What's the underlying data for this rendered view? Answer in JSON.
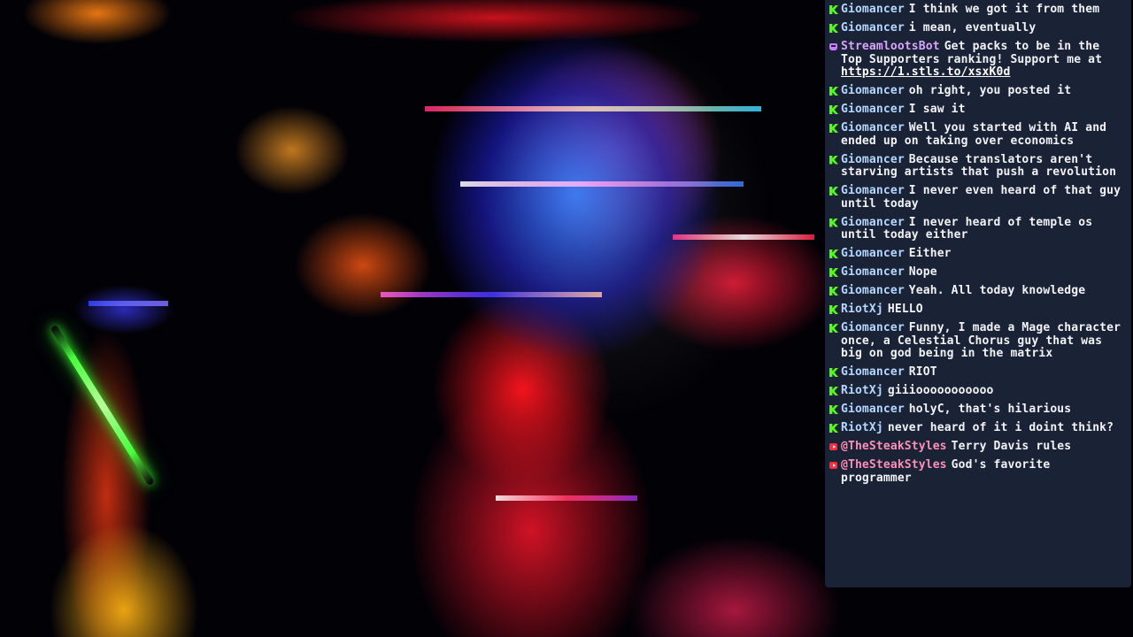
{
  "colors": {
    "kick_username": "#b4d8ff",
    "youtube_username": "#ff8fb8",
    "bot_username": "#d9a3ff",
    "chat_text": "#f1f3f7",
    "chat_panel_bg": "#1c2438",
    "kick_icon": "#53fc18",
    "youtube_icon": "#ff2b3a",
    "bot_icon": "#c77dff"
  },
  "chat": {
    "messages": [
      {
        "platform_icon": "kick-icon",
        "username": "Giomancer",
        "text": "I think we got it from them"
      },
      {
        "platform_icon": "kick-icon",
        "username": "Giomancer",
        "text": "i mean, eventually"
      },
      {
        "platform_icon": "bot-icon",
        "username": "StreamlootsBot",
        "text": "Get packs to be in the Top Supporters ranking! Support me at",
        "link": "https://1.stls.to/xsxK0d"
      },
      {
        "platform_icon": "kick-icon",
        "username": "Giomancer",
        "text": "oh right, you posted it"
      },
      {
        "platform_icon": "kick-icon",
        "username": "Giomancer",
        "text": "I saw it"
      },
      {
        "platform_icon": "kick-icon",
        "username": "Giomancer",
        "text": "Well you started with AI and ended up on taking over economics"
      },
      {
        "platform_icon": "kick-icon",
        "username": "Giomancer",
        "text": "Because translators aren't starving artists that push a revolution"
      },
      {
        "platform_icon": "kick-icon",
        "username": "Giomancer",
        "text": "I never even heard of that guy until today"
      },
      {
        "platform_icon": "kick-icon",
        "username": "Giomancer",
        "text": "I never heard of temple os until today either"
      },
      {
        "platform_icon": "kick-icon",
        "username": "Giomancer",
        "text": "Either"
      },
      {
        "platform_icon": "kick-icon",
        "username": "Giomancer",
        "text": "Nope"
      },
      {
        "platform_icon": "kick-icon",
        "username": "Giomancer",
        "text": "Yeah. All today knowledge"
      },
      {
        "platform_icon": "kick-icon",
        "username": "RiotXj",
        "text": "HELLO"
      },
      {
        "platform_icon": "kick-icon",
        "username": "Giomancer",
        "text": "Funny, I made a Mage character once, a Celestial Chorus guy that was big on god being in the matrix"
      },
      {
        "platform_icon": "kick-icon",
        "username": "Giomancer",
        "text": "RIOT"
      },
      {
        "platform_icon": "kick-icon",
        "username": "RiotXj",
        "text": "giiiooooooooooo"
      },
      {
        "platform_icon": "kick-icon",
        "username": "Giomancer",
        "text": "holyC, that's hilarious"
      },
      {
        "platform_icon": "kick-icon",
        "username": "RiotXj",
        "text": "never heard of it i doint think?"
      },
      {
        "platform_icon": "youtube-icon",
        "username": "@TheSteakStyles",
        "text": "Terry Davis rules"
      },
      {
        "platform_icon": "youtube-icon",
        "username": "@TheSteakStyles",
        "text": "God's favorite programmer"
      }
    ]
  }
}
